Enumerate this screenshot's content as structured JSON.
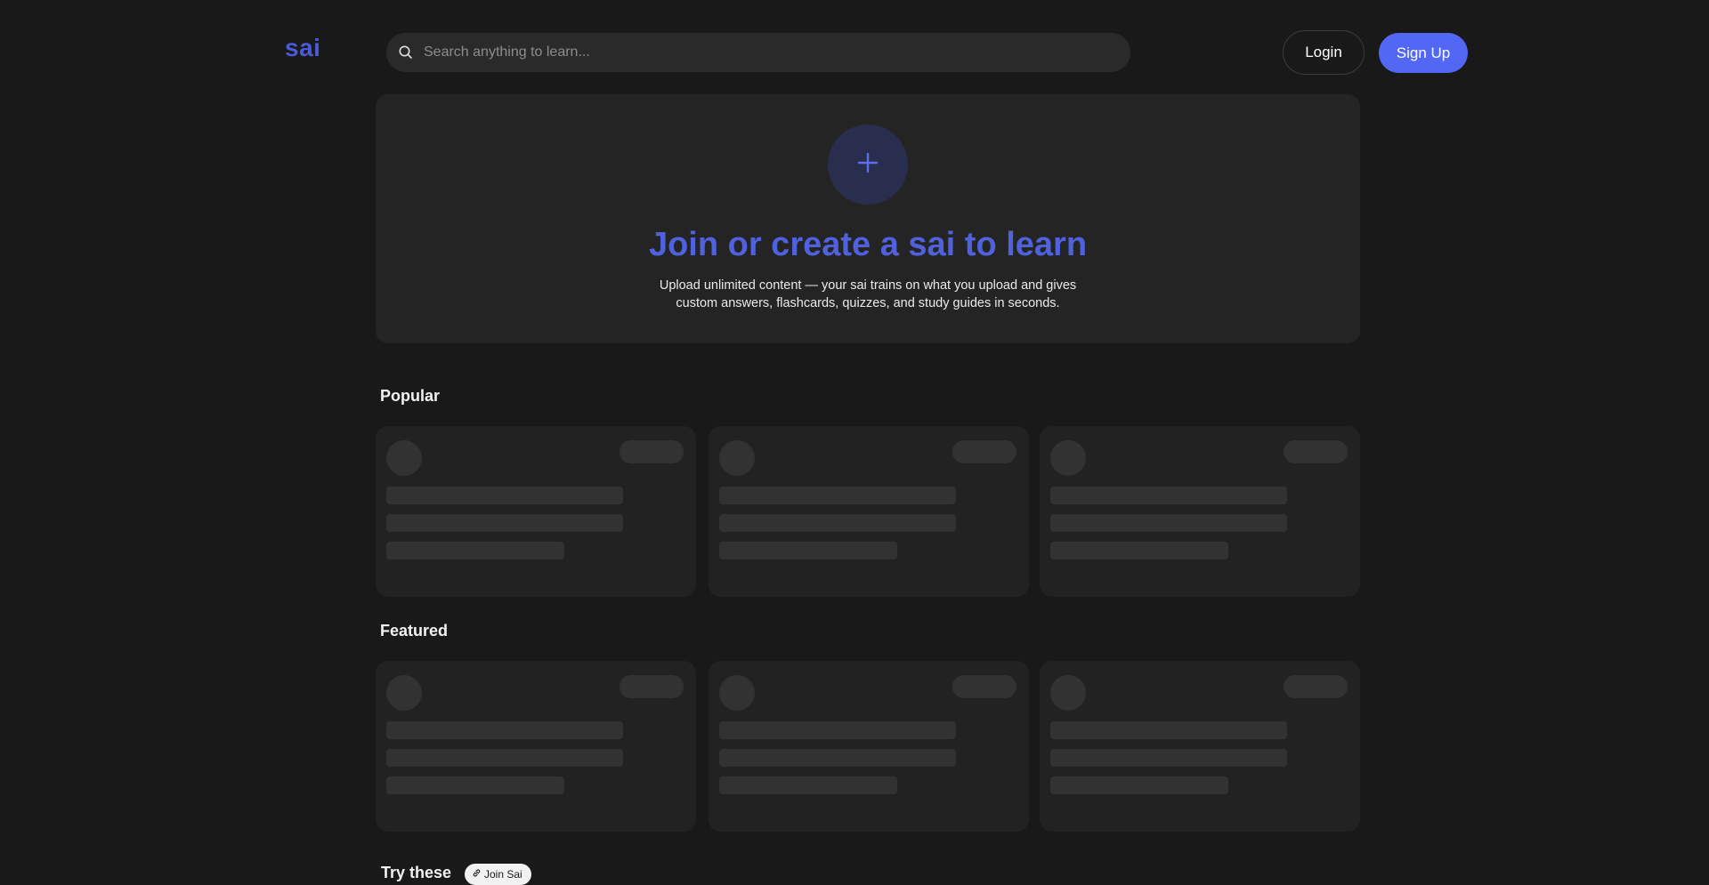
{
  "header": {
    "logo": "sai",
    "search_placeholder": "Search anything to learn...",
    "login_label": "Login",
    "signup_label": "Sign Up"
  },
  "hero": {
    "add_icon": "plus-icon",
    "title": "Join or create a sai to learn",
    "description": "Upload unlimited content — your sai trains on what you upload and gives custom answers, flashcards, quizzes, and study guides in seconds."
  },
  "sections": {
    "popular": {
      "title": "Popular",
      "card_count": 3
    },
    "featured": {
      "title": "Featured",
      "card_count": 3
    },
    "try_these": {
      "title": "Try these",
      "badge_label": "Join Sai",
      "badge_icon": "link-icon"
    }
  },
  "colors": {
    "background": "#191919",
    "card": "#222222",
    "accent": "#4f61dd",
    "signup_button": "#5367f5",
    "skeleton": "#323232"
  }
}
